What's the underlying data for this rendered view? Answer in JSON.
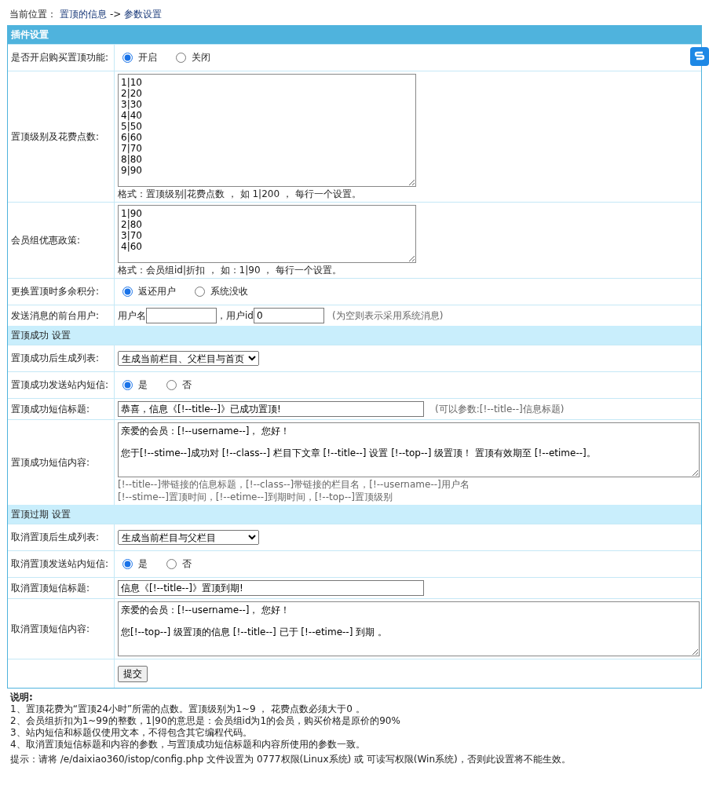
{
  "breadcrumb": {
    "label": "当前位置：",
    "path": [
      "置顶的信息",
      "参数设置"
    ],
    "separator": "->"
  },
  "sections": [
    {
      "title": "插件设置",
      "kind": "main",
      "rows": [
        {
          "kind": "radio",
          "label": "是否开启购买置顶功能:",
          "options": [
            {
              "label": "开启",
              "selected": true
            },
            {
              "label": "关闭",
              "selected": false
            }
          ]
        },
        {
          "kind": "textarea",
          "label": "置顶级别及花费点数:",
          "value": "1|10\n2|20\n3|30\n4|40\n5|50\n6|60\n7|70\n8|80\n9|90",
          "hint": "格式：置顶级别|花费点数 ， 如 1|200 ， 每行一个设置。"
        },
        {
          "kind": "textarea",
          "label": "会员组优惠政策:",
          "value": "1|90\n2|80\n3|70\n4|60",
          "hint": "格式：会员组id|折扣 ， 如：1|90 ， 每行一个设置。"
        },
        {
          "kind": "radio",
          "label": "更换置顶时多余积分:",
          "options": [
            {
              "label": "返还用户",
              "selected": true
            },
            {
              "label": "系统没收",
              "selected": false
            }
          ]
        },
        {
          "kind": "user",
          "label": "发送消息的前台用户:",
          "fields": [
            {
              "prefix": "用户名"
            },
            {
              "prefix": "，用户id",
              "value": "0"
            }
          ],
          "note": "(为空则表示采用系统消息)"
        }
      ]
    },
    {
      "title": "置顶成功 设置",
      "kind": "sub",
      "rows": [
        {
          "kind": "select",
          "label": "置顶成功后生成列表:",
          "value": "生成当前栏目、父栏目与首页"
        },
        {
          "kind": "radio",
          "label": "置顶成功发送站内短信:",
          "options": [
            {
              "label": "是",
              "selected": true
            },
            {
              "label": "否",
              "selected": false
            }
          ]
        },
        {
          "kind": "text",
          "label": "置顶成功短信标题:",
          "value": "恭喜，信息《[!--title--]》已成功置顶!",
          "note": "(可以参数:[!--title--]信息标题)"
        },
        {
          "kind": "message",
          "label": "置顶成功短信内容:",
          "paragraphs": [
            "亲爱的会员：[!--username--]， 您好！",
            "您于[!--stime--]成功对 [!--class--] 栏目下文章 [!--title--] 设置 [!--top--] 级置顶！ 置顶有效期至 [!--etime--]。"
          ],
          "hints": [
            "[!--title--]带链接的信息标题，[!--class--]带链接的栏目名，[!--username--]用户名",
            "[!--stime--]置顶时间，[!--etime--]到期时间，[!--top--]置顶级别"
          ]
        }
      ]
    },
    {
      "title": "置顶过期 设置",
      "kind": "sub",
      "rows": [
        {
          "kind": "select",
          "label": "取消置顶后生成列表:",
          "value": "生成当前栏目与父栏目"
        },
        {
          "kind": "radio",
          "label": "取消置顶发送站内短信:",
          "options": [
            {
              "label": "是",
              "selected": true
            },
            {
              "label": "否",
              "selected": false
            }
          ]
        },
        {
          "kind": "text",
          "label": "取消置顶短信标题:",
          "value": "信息《[!--title--]》置顶到期!"
        },
        {
          "kind": "message",
          "label": "取消置顶短信内容:",
          "paragraphs": [
            "亲爱的会员：[!--username--]， 您好！",
            "您[!--top--] 级置顶的信息 [!--title--] 已于 [!--etime--] 到期 。"
          ]
        },
        {
          "kind": "submit",
          "label": "提交"
        }
      ]
    }
  ],
  "notes": {
    "title": "说明:",
    "items": [
      "1、置顶花费为“置顶24小时”所需的点数。置顶级别为1~9 ， 花费点数必须大于0 。",
      "2、会员组折扣为1~99的整数，1|90的意思是：会员组id为1的会员，购买价格是原价的90%",
      "3、站内短信和标题仅使用文本，不得包含其它编程代码。",
      "4、取消置顶短信标题和内容的参数，与置顶成功短信标题和内容所使用的参数一致。"
    ],
    "tip": "提示：请将 /e/daixiao360/istop/config.php 文件设置为 0777权限(Linux系统) 或 可读写权限(Win系统)，否则此设置将不能生效。"
  }
}
